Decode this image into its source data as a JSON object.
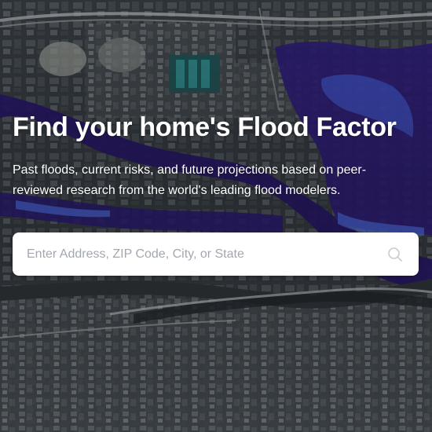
{
  "hero": {
    "title": "Find your home's Flood Factor",
    "subtitle": "Past floods, current risks, and future projections based on peer-reviewed research from the world's leading flood modelers."
  },
  "search": {
    "placeholder": "Enter Address, ZIP Code, City, or State",
    "value": "",
    "icon": "search-icon"
  },
  "colors": {
    "title_text": "#ffffff",
    "placeholder_text": "#a3a8ae",
    "search_background": "#ffffff",
    "flood_overlay_dark": "#2a1a6e",
    "flood_overlay_light": "#3f5fd0"
  }
}
